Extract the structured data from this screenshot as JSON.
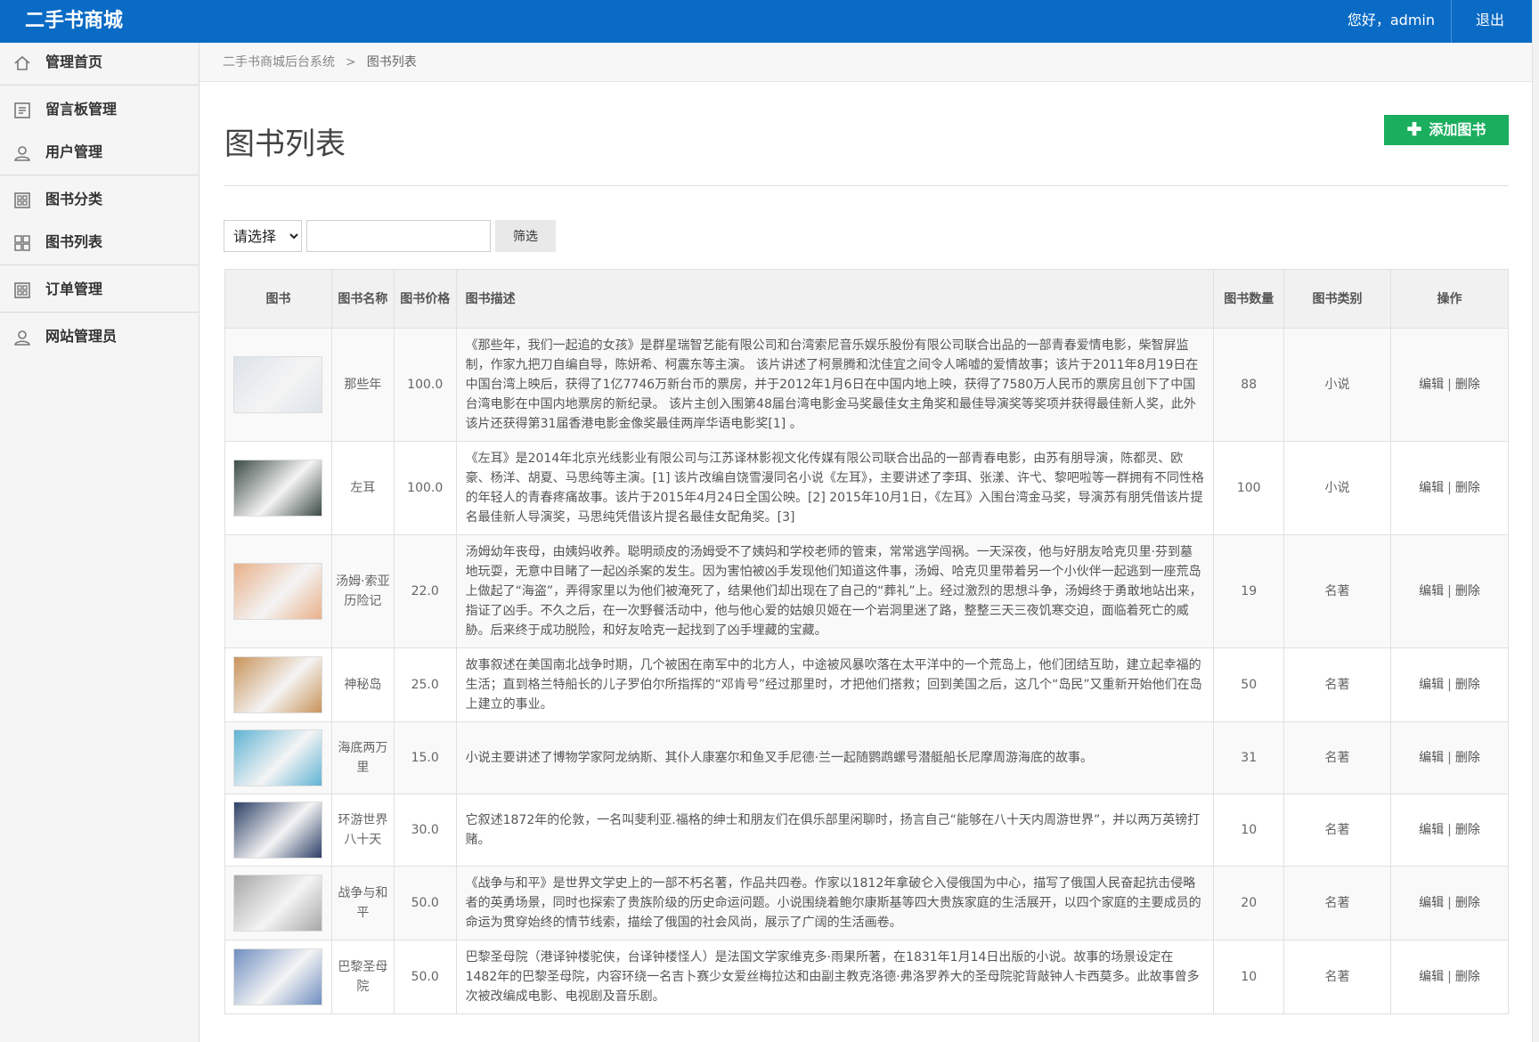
{
  "app": {
    "brand": "二手书商城"
  },
  "topbar": {
    "greeting": "您好，admin",
    "logout": "退出"
  },
  "sidebar": {
    "items": [
      {
        "label": "管理首页",
        "icon": "home-icon"
      },
      {
        "label": "留言板管理",
        "icon": "message-board-icon"
      },
      {
        "label": "用户管理",
        "icon": "user-icon"
      },
      {
        "label": "图书分类",
        "icon": "grid-icon"
      },
      {
        "label": "图书列表",
        "icon": "grid-icon"
      },
      {
        "label": "订单管理",
        "icon": "grid-icon"
      },
      {
        "label": "网站管理员",
        "icon": "user-icon"
      }
    ]
  },
  "breadcrumb": {
    "root": "二手书商城后台系统",
    "separator": ">",
    "current": "图书列表"
  },
  "page": {
    "title": "图书列表",
    "add_button": "添加图书"
  },
  "filter": {
    "select_value": "请选择",
    "input_value": "",
    "button": "筛选"
  },
  "table": {
    "headers": [
      "图书",
      "图书名称",
      "图书价格",
      "图书描述",
      "图书数量",
      "图书类别",
      "操作"
    ],
    "edit_label": "编辑",
    "delete_label": "删除",
    "rows": [
      {
        "name": "那些年",
        "price": "100.0",
        "qty": "88",
        "category": "小说",
        "cover": "#dde3ea",
        "desc": "《那些年，我们一起追的女孩》是群星瑞智艺能有限公司和台湾索尼音乐娱乐股份有限公司联合出品的一部青春爱情电影，柴智屏监制，作家九把刀自编自导，陈妍希、柯震东等主演。 该片讲述了柯景腾和沈佳宜之间令人唏嘘的爱情故事；该片于2011年8月19日在中国台湾上映后，获得了1亿7746万新台币的票房，并于2012年1月6日在中国内地上映，获得了7580万人民币的票房且创下了中国台湾电影在中国内地票房的新纪录。 该片主创入围第48届台湾电影金马奖最佳女主角奖和最佳导演奖等奖项并获得最佳新人奖，此外该片还获得第31届香港电影金像奖最佳两岸华语电影奖[1] 。"
      },
      {
        "name": "左耳",
        "price": "100.0",
        "qty": "100",
        "category": "小说",
        "cover": "#3b4a44",
        "desc": "《左耳》是2014年北京光线影业有限公司与江苏译林影视文化传媒有限公司联合出品的一部青春电影，由苏有朋导演，陈都灵、欧豪、杨洋、胡夏、马思纯等主演。[1] 该片改编自饶雪漫同名小说《左耳》，主要讲述了李珥、张漾、许弋、黎吧啦等一群拥有不同性格的年轻人的青春疼痛故事。该片于2015年4月24日全国公映。[2] 2015年10月1日，《左耳》入围台湾金马奖，导演苏有朋凭借该片提名最佳新人导演奖，马思纯凭借该片提名最佳女配角奖。[3]"
      },
      {
        "name": "汤姆·索亚历险记",
        "price": "22.0",
        "qty": "19",
        "category": "名著",
        "cover": "#e8b08a",
        "desc": "汤姆幼年丧母，由姨妈收养。聪明顽皮的汤姆受不了姨妈和学校老师的管束，常常逃学闯祸。一天深夜，他与好朋友哈克贝里·芬到墓地玩耍，无意中目睹了一起凶杀案的发生。因为害怕被凶手发现他们知道这件事，汤姆、哈克贝里带着另一个小伙伴一起逃到一座荒岛上做起了“海盗”，弄得家里以为他们被淹死了，结果他们却出现在了自己的“葬礼”上。经过激烈的思想斗争，汤姆终于勇敢地站出来，指证了凶手。不久之后，在一次野餐活动中，他与他心爱的姑娘贝姬在一个岩洞里迷了路，整整三天三夜饥寒交迫，面临着死亡的威胁。后来终于成功脱险，和好友哈克一起找到了凶手埋藏的宝藏。"
      },
      {
        "name": "神秘岛",
        "price": "25.0",
        "qty": "50",
        "category": "名著",
        "cover": "#c8935a",
        "desc": "故事叙述在美国南北战争时期，几个被困在南军中的北方人，中途被风暴吹落在太平洋中的一个荒岛上，他们团结互助，建立起幸福的生活；直到格兰特船长的儿子罗伯尔所指挥的“邓肯号”经过那里时，才把他们搭救；回到美国之后，这几个“岛民”又重新开始他们在岛上建立的事业。"
      },
      {
        "name": "海底两万里",
        "price": "15.0",
        "qty": "31",
        "category": "名著",
        "cover": "#5fb3d4",
        "desc": "小说主要讲述了博物学家阿龙纳斯、其仆人康塞尔和鱼叉手尼德·兰一起随鹦鹉螺号潜艇船长尼摩周游海底的故事。"
      },
      {
        "name": "环游世界八十天",
        "price": "30.0",
        "qty": "10",
        "category": "名著",
        "cover": "#2c3f66",
        "desc": "它叙述1872年的伦敦，一名叫斐利亚.福格的绅士和朋友们在俱乐部里闲聊时，扬言自己“能够在八十天内周游世界”，并以两万英镑打赌。"
      },
      {
        "name": "战争与和平",
        "price": "50.0",
        "qty": "20",
        "category": "名著",
        "cover": "#a7a7a7",
        "desc": "《战争与和平》是世界文学史上的一部不朽名著，作品共四卷。作家以1812年拿破仑入侵俄国为中心，描写了俄国人民奋起抗击侵略者的英勇场景，同时也探索了贵族阶级的历史命运问题。小说围绕着鲍尔康斯基等四大贵族家庭的生活展开，以四个家庭的主要成员的命运为贯穿始终的情节线索，描绘了俄国的社会风尚，展示了广阔的生活画卷。"
      },
      {
        "name": "巴黎圣母院",
        "price": "50.0",
        "qty": "10",
        "category": "名著",
        "cover": "#6f8fc0",
        "desc": "巴黎圣母院（港译钟楼驼侠，台译钟楼怪人）是法国文学家维克多·雨果所著，在1831年1月14日出版的小说。故事的场景设定在1482年的巴黎圣母院，内容环绕一名吉卜赛少女爱丝梅拉达和由副主教克洛德·弗洛罗养大的圣母院驼背敲钟人卡西莫多。此故事曾多次被改编成电影、电视剧及音乐剧。"
      }
    ]
  }
}
